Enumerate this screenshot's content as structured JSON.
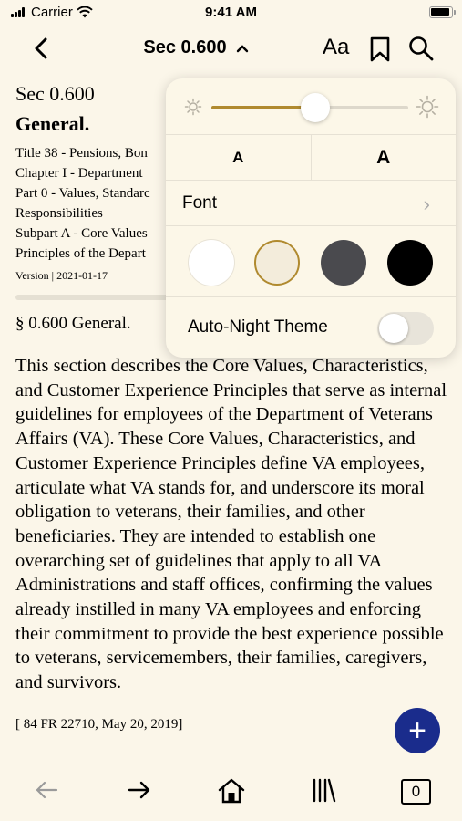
{
  "status": {
    "carrier": "Carrier",
    "time": "9:41 AM"
  },
  "nav": {
    "title": "Sec 0.600",
    "title_chevron": "^",
    "font_button": "Aa"
  },
  "document": {
    "section": "Sec 0.600",
    "heading": "General.",
    "meta_lines": [
      "Title 38 - Pensions, Bon",
      "Chapter I - Department",
      "Part 0 - Values, Standarc",
      "Responsibilities",
      "Subpart A - Core Values",
      "Principles of the Depart"
    ],
    "version": "Version | 2021-01-17",
    "paragraph_title": "§ 0.600 General.",
    "body": "This section describes the Core Values, Characteristics, and Customer Experience Principles that serve as internal guidelines for employees of the Department of Veterans Affairs (VA). These Core Values, Characteristics, and Customer Experience Principles define VA employees, articulate what VA stands for, and underscore its moral obligation to veterans, their families, and other beneficiaries. They are intended to establish one overarching set of guidelines that apply to all VA Administrations and staff offices, confirming the values already instilled in many VA employees and enforcing their commitment to provide the best experience possible to veterans, servicemembers, their families, caregivers, and survivors.",
    "citation": "[ 84 FR 22710, May 20, 2019]"
  },
  "appearance_popover": {
    "brightness_level": 0.53,
    "text_size_small": "A",
    "text_size_large": "A",
    "font_label": "Font",
    "font_chevron": "›",
    "themes": [
      {
        "name": "white",
        "color": "#ffffff",
        "selected": false
      },
      {
        "name": "sepia",
        "color": "#f3ecdb",
        "selected": true
      },
      {
        "name": "gray",
        "color": "#4a4a4e",
        "selected": false
      },
      {
        "name": "black",
        "color": "#000000",
        "selected": false
      }
    ],
    "accent_color": "#b08a2f",
    "auto_night_label": "Auto-Night Theme",
    "auto_night_on": false
  },
  "fab": {
    "label": "+",
    "color": "#1a2c8c"
  },
  "toolbar": {
    "tab_count": "0"
  }
}
